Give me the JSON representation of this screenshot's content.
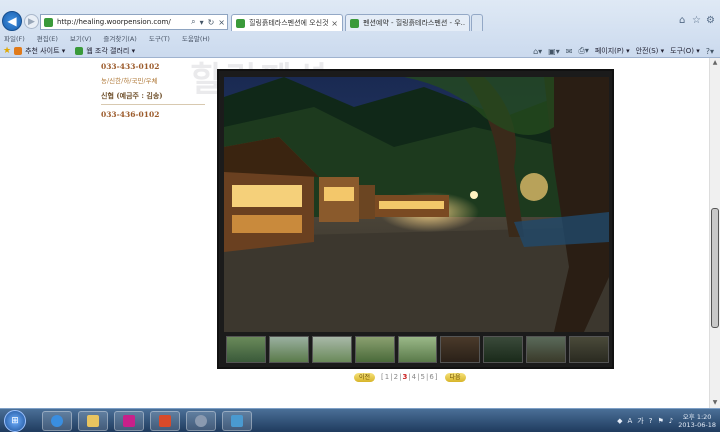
{
  "browser": {
    "url": "http://healing.woorpension.com/",
    "tabs": [
      {
        "label": "힐링흙테라스펜션에 오신것을 ..."
      },
      {
        "label": "펜션예약 - 힐링흙테라스펜션 - 우..."
      }
    ],
    "menu": [
      "파일(F)",
      "편집(E)",
      "보기(V)",
      "즐겨찾기(A)",
      "도구(T)",
      "도움말(H)"
    ],
    "favorites": [
      {
        "label": "추천 사이트 ▾",
        "icon": "suggested-sites-icon",
        "color": "#e07a1a"
      },
      {
        "label": "웹 조각 갤러리 ▾",
        "icon": "web-slice-icon",
        "color": "#3a9a3a"
      }
    ],
    "commands": {
      "page": "페이지(P) ▾",
      "safety": "안전(S) ▾",
      "tools": "도구(O) ▾"
    }
  },
  "page": {
    "watermark": "힐링펜션",
    "contact": {
      "phone1": "033-433-0102",
      "banks": "농/신한/하/국민/우체",
      "account_label": "신협 (예금주 : 김송)",
      "phone2": "033-436-0102"
    },
    "pager": {
      "prev_label": "이전",
      "next_label": "다음",
      "pages": [
        "1",
        "2",
        "3",
        "4",
        "5",
        "6"
      ],
      "current": "3"
    },
    "colors": {
      "accent": "#c22222",
      "brown": "#9b5a2a"
    }
  },
  "taskbar": {
    "clock_time": "오후 1:20",
    "clock_date": "2013-06-18",
    "apps": [
      "internet-explorer-icon",
      "file-explorer-icon",
      "media-app-icon",
      "pdf-app-icon",
      "settings-app-icon",
      "image-viewer-icon"
    ]
  }
}
